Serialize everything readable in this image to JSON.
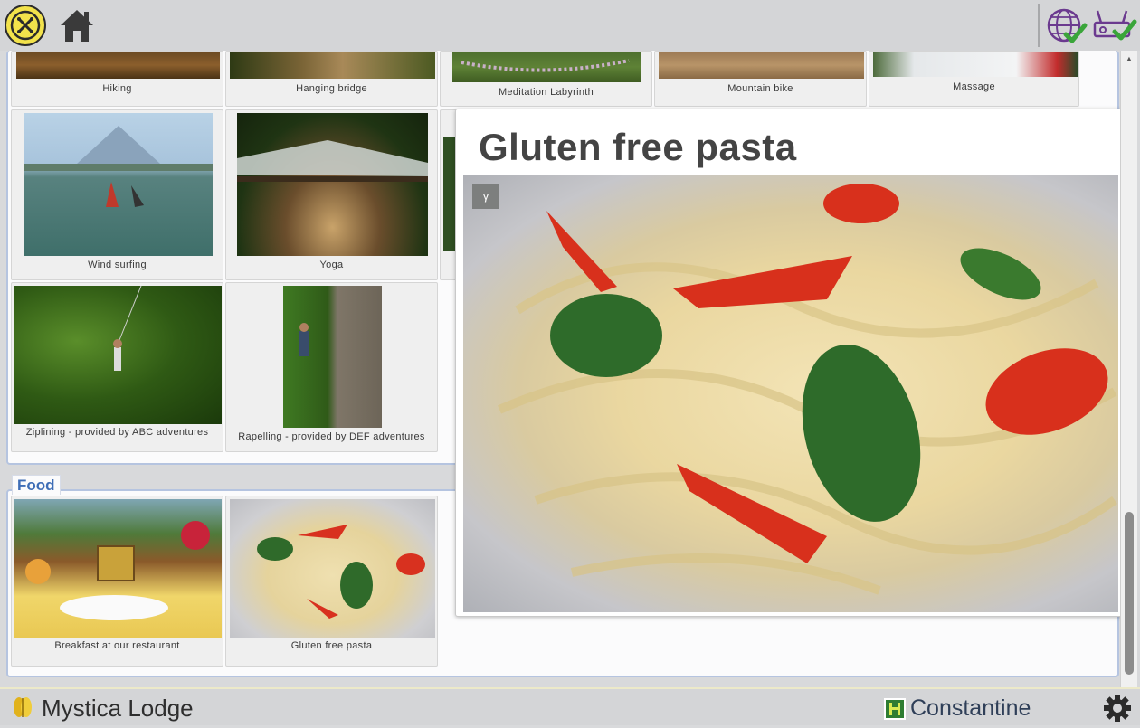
{
  "activities": [
    {
      "caption": "Hiking"
    },
    {
      "caption": "Hanging bridge"
    },
    {
      "caption": "Meditation Labyrinth"
    },
    {
      "caption": "Mountain bike"
    },
    {
      "caption": "Massage"
    },
    {
      "caption": "Wind surfing"
    },
    {
      "caption": "Yoga"
    },
    {
      "caption": "Ziplining - provided by ABC adventures"
    },
    {
      "caption": "Rapelling - provided by DEF adventures"
    }
  ],
  "food": {
    "section_label": "Food",
    "items": [
      {
        "caption": "Breakfast at our restaurant"
      },
      {
        "caption": "Gluten free pasta"
      }
    ]
  },
  "popup": {
    "title": "Gluten free pasta",
    "badge": "γ"
  },
  "footer": {
    "lodge_name": "Mystica Lodge",
    "user_name": "Constantine"
  },
  "icons": {
    "top_left": "close-circle-icon",
    "home": "home-icon",
    "globe_status": "globe-check-icon",
    "router_status": "router-check-icon",
    "settings": "gear-icon"
  },
  "colors": {
    "accent": "#3e6db6",
    "brand_yellow": "#f2e24b",
    "check_green": "#3aa53a"
  }
}
